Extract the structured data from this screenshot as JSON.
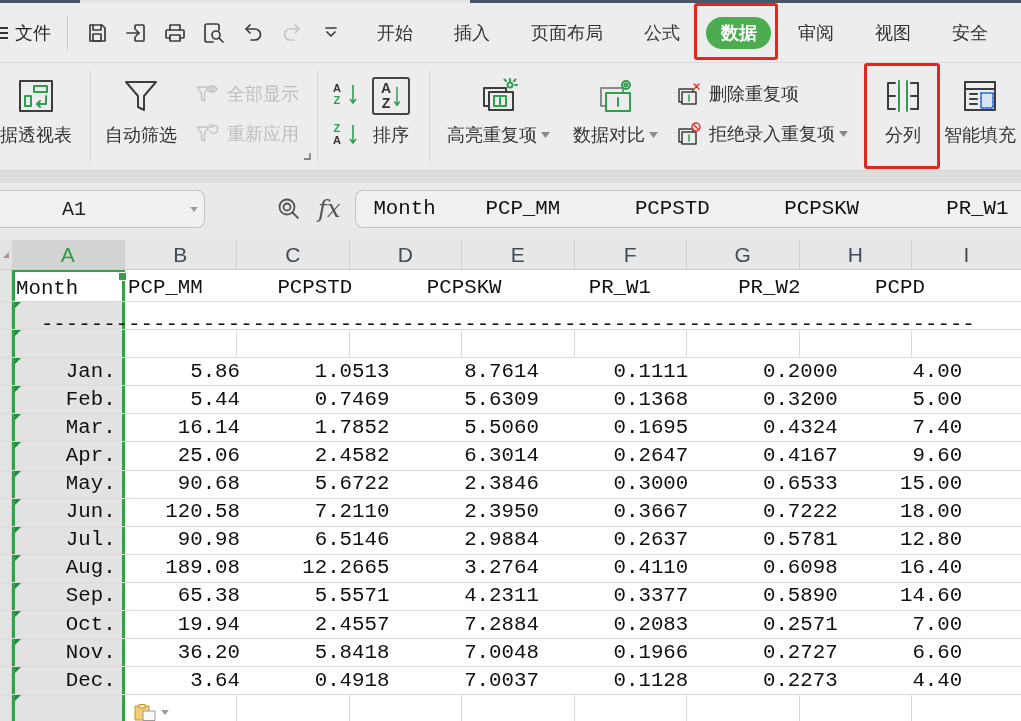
{
  "menu_bar": {
    "file_menu": "文件",
    "quick_access": [
      {
        "disabled": false
      },
      {
        "disabled": false
      },
      {
        "disabled": false
      },
      {
        "disabled": false
      },
      {
        "disabled": false
      },
      {
        "disabled": true
      },
      {
        "disabled": false
      }
    ],
    "tabs": [
      {
        "label": "开始",
        "selected": false,
        "highlighted": false
      },
      {
        "label": "插入",
        "selected": false,
        "highlighted": false
      },
      {
        "label": "页面布局",
        "selected": false,
        "highlighted": false
      },
      {
        "label": "公式",
        "selected": false,
        "highlighted": false
      },
      {
        "label": "数据",
        "selected": true,
        "highlighted": true
      },
      {
        "label": "审阅",
        "selected": false,
        "highlighted": false
      },
      {
        "label": "视图",
        "selected": false,
        "highlighted": false
      },
      {
        "label": "安全",
        "selected": false,
        "highlighted": false
      }
    ]
  },
  "ribbon": {
    "groups": [
      {
        "launcher": false,
        "items": [
          {
            "kind": "large",
            "label": "据透视表",
            "disabled": false,
            "dropdown": false,
            "highlighted": false
          }
        ]
      },
      {
        "launcher": true,
        "items": [
          {
            "kind": "large",
            "label": "自动筛选",
            "disabled": false,
            "dropdown": false,
            "highlighted": false
          },
          {
            "kind": "stack",
            "items": [
              {
                "kind": "text",
                "label": "全部显示",
                "disabled": true,
                "dropdown": false
              },
              {
                "kind": "text",
                "label": "重新应用",
                "disabled": true,
                "dropdown": false
              }
            ]
          }
        ]
      },
      {
        "launcher": false,
        "items": [
          {
            "kind": "stack",
            "items": [
              {
                "kind": "glyph",
                "glyphs": [
                  "A",
                  "Z"
                ],
                "disabled": false
              },
              {
                "kind": "glyph",
                "glyphs": [
                  "Z",
                  "A"
                ],
                "disabled": false
              }
            ]
          },
          {
            "kind": "large",
            "label": "排序",
            "glyphs": [
              "A",
              "Z"
            ],
            "disabled": false,
            "dropdown": false,
            "highlighted": false
          }
        ]
      },
      {
        "launcher": false,
        "items": [
          {
            "kind": "large",
            "label": "高亮重复项",
            "disabled": false,
            "dropdown": true,
            "highlighted": false
          },
          {
            "kind": "large",
            "label": "数据对比",
            "disabled": false,
            "dropdown": true,
            "highlighted": false
          },
          {
            "kind": "stack",
            "items": [
              {
                "kind": "text",
                "label": "删除重复项",
                "disabled": false,
                "dropdown": false
              },
              {
                "kind": "text",
                "label": "拒绝录入重复项",
                "disabled": false,
                "dropdown": true
              }
            ]
          },
          {
            "kind": "large",
            "label": "分列",
            "disabled": false,
            "dropdown": false,
            "highlighted": true
          },
          {
            "kind": "large",
            "label": "智能填充",
            "disabled": false,
            "dropdown": false,
            "highlighted": false
          }
        ]
      }
    ]
  },
  "formula_bar": {
    "cell_ref": "A1",
    "fx": "fx",
    "content": "Month    PCP_MM      PCPSTD      PCPSKW       PR_W1"
  },
  "sheet": {
    "columns": [
      {
        "label": "A",
        "selected": true
      },
      {
        "label": "B",
        "selected": false
      },
      {
        "label": "C",
        "selected": false
      },
      {
        "label": "D",
        "selected": false
      },
      {
        "label": "E",
        "selected": false
      },
      {
        "label": "F",
        "selected": false
      },
      {
        "label": "G",
        "selected": false
      },
      {
        "label": "H",
        "selected": false
      },
      {
        "label": "I",
        "selected": false
      }
    ],
    "rows": [
      {
        "kind": "header",
        "flag": false,
        "active": true,
        "cells": [
          "Month",
          "PCP_MM",
          "PCPSTD",
          "PCPSKW",
          "PR_W1",
          "PR_W2",
          "PCPD"
        ]
      },
      {
        "kind": "rule",
        "flag": true,
        "active": false,
        "text": "---------------------------------------------------------------------------"
      },
      {
        "kind": "empty",
        "flag": true,
        "active": false
      },
      {
        "kind": "data",
        "flag": true,
        "active": false,
        "cells": [
          "Jan.",
          "5.86",
          "1.0513",
          "8.7614",
          "0.1111",
          "0.2000",
          "4.00"
        ]
      },
      {
        "kind": "data",
        "flag": true,
        "active": false,
        "cells": [
          "Feb.",
          "5.44",
          "0.7469",
          "5.6309",
          "0.1368",
          "0.3200",
          "5.00"
        ]
      },
      {
        "kind": "data",
        "flag": true,
        "active": false,
        "cells": [
          "Mar.",
          "16.14",
          "1.7852",
          "5.5060",
          "0.1695",
          "0.4324",
          "7.40"
        ]
      },
      {
        "kind": "data",
        "flag": true,
        "active": false,
        "cells": [
          "Apr.",
          "25.06",
          "2.4582",
          "6.3014",
          "0.2647",
          "0.4167",
          "9.60"
        ]
      },
      {
        "kind": "data",
        "flag": true,
        "active": false,
        "cells": [
          "May.",
          "90.68",
          "5.6722",
          "2.3846",
          "0.3000",
          "0.6533",
          "15.00"
        ]
      },
      {
        "kind": "data",
        "flag": true,
        "active": false,
        "cells": [
          "Jun.",
          "120.58",
          "7.2110",
          "2.3950",
          "0.3667",
          "0.7222",
          "18.00"
        ]
      },
      {
        "kind": "data",
        "flag": true,
        "active": false,
        "cells": [
          "Jul.",
          "90.98",
          "6.5146",
          "2.9884",
          "0.2637",
          "0.5781",
          "12.80"
        ]
      },
      {
        "kind": "data",
        "flag": true,
        "active": false,
        "cells": [
          "Aug.",
          "189.08",
          "12.2665",
          "3.2764",
          "0.4110",
          "0.6098",
          "16.40"
        ]
      },
      {
        "kind": "data",
        "flag": true,
        "active": false,
        "cells": [
          "Sep.",
          "65.38",
          "5.5571",
          "4.2311",
          "0.3377",
          "0.5890",
          "14.60"
        ]
      },
      {
        "kind": "data",
        "flag": true,
        "active": false,
        "cells": [
          "Oct.",
          "19.94",
          "2.4557",
          "7.2884",
          "0.2083",
          "0.2571",
          "7.00"
        ]
      },
      {
        "kind": "data",
        "flag": true,
        "active": false,
        "cells": [
          "Nov.",
          "36.20",
          "5.8418",
          "7.0048",
          "0.1966",
          "0.2727",
          "6.60"
        ]
      },
      {
        "kind": "data",
        "flag": true,
        "active": false,
        "cells": [
          "Dec.",
          "3.64",
          "0.4918",
          "7.0037",
          "0.1128",
          "0.2273",
          "4.40"
        ]
      },
      {
        "kind": "empty",
        "flag": true,
        "active": false
      }
    ],
    "paste_options": true
  }
}
